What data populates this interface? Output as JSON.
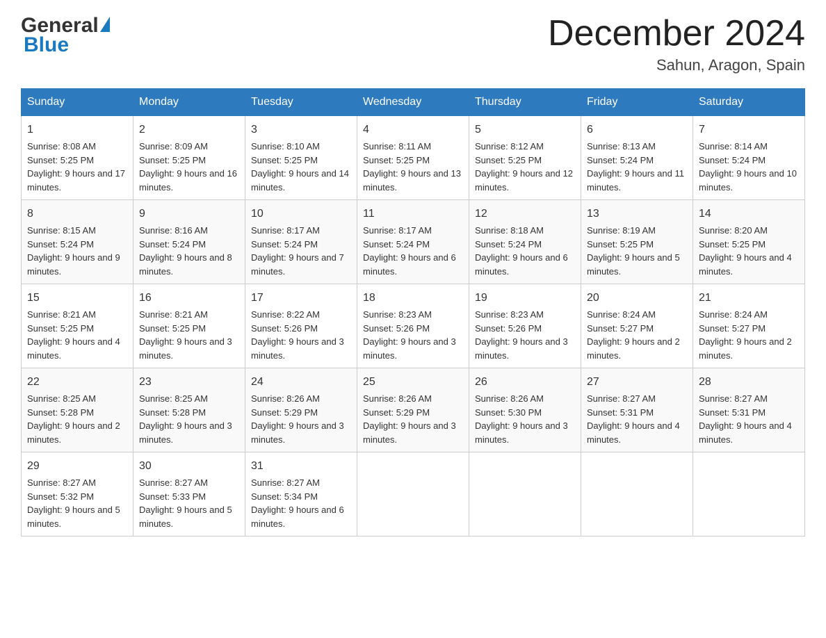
{
  "header": {
    "logo_general": "General",
    "logo_blue": "Blue",
    "month_title": "December 2024",
    "subtitle": "Sahun, Aragon, Spain"
  },
  "days_of_week": [
    "Sunday",
    "Monday",
    "Tuesday",
    "Wednesday",
    "Thursday",
    "Friday",
    "Saturday"
  ],
  "weeks": [
    [
      {
        "day": "1",
        "sunrise": "8:08 AM",
        "sunset": "5:25 PM",
        "daylight": "9 hours and 17 minutes."
      },
      {
        "day": "2",
        "sunrise": "8:09 AM",
        "sunset": "5:25 PM",
        "daylight": "9 hours and 16 minutes."
      },
      {
        "day": "3",
        "sunrise": "8:10 AM",
        "sunset": "5:25 PM",
        "daylight": "9 hours and 14 minutes."
      },
      {
        "day": "4",
        "sunrise": "8:11 AM",
        "sunset": "5:25 PM",
        "daylight": "9 hours and 13 minutes."
      },
      {
        "day": "5",
        "sunrise": "8:12 AM",
        "sunset": "5:25 PM",
        "daylight": "9 hours and 12 minutes."
      },
      {
        "day": "6",
        "sunrise": "8:13 AM",
        "sunset": "5:24 PM",
        "daylight": "9 hours and 11 minutes."
      },
      {
        "day": "7",
        "sunrise": "8:14 AM",
        "sunset": "5:24 PM",
        "daylight": "9 hours and 10 minutes."
      }
    ],
    [
      {
        "day": "8",
        "sunrise": "8:15 AM",
        "sunset": "5:24 PM",
        "daylight": "9 hours and 9 minutes."
      },
      {
        "day": "9",
        "sunrise": "8:16 AM",
        "sunset": "5:24 PM",
        "daylight": "9 hours and 8 minutes."
      },
      {
        "day": "10",
        "sunrise": "8:17 AM",
        "sunset": "5:24 PM",
        "daylight": "9 hours and 7 minutes."
      },
      {
        "day": "11",
        "sunrise": "8:17 AM",
        "sunset": "5:24 PM",
        "daylight": "9 hours and 6 minutes."
      },
      {
        "day": "12",
        "sunrise": "8:18 AM",
        "sunset": "5:24 PM",
        "daylight": "9 hours and 6 minutes."
      },
      {
        "day": "13",
        "sunrise": "8:19 AM",
        "sunset": "5:25 PM",
        "daylight": "9 hours and 5 minutes."
      },
      {
        "day": "14",
        "sunrise": "8:20 AM",
        "sunset": "5:25 PM",
        "daylight": "9 hours and 4 minutes."
      }
    ],
    [
      {
        "day": "15",
        "sunrise": "8:21 AM",
        "sunset": "5:25 PM",
        "daylight": "9 hours and 4 minutes."
      },
      {
        "day": "16",
        "sunrise": "8:21 AM",
        "sunset": "5:25 PM",
        "daylight": "9 hours and 3 minutes."
      },
      {
        "day": "17",
        "sunrise": "8:22 AM",
        "sunset": "5:26 PM",
        "daylight": "9 hours and 3 minutes."
      },
      {
        "day": "18",
        "sunrise": "8:23 AM",
        "sunset": "5:26 PM",
        "daylight": "9 hours and 3 minutes."
      },
      {
        "day": "19",
        "sunrise": "8:23 AM",
        "sunset": "5:26 PM",
        "daylight": "9 hours and 3 minutes."
      },
      {
        "day": "20",
        "sunrise": "8:24 AM",
        "sunset": "5:27 PM",
        "daylight": "9 hours and 2 minutes."
      },
      {
        "day": "21",
        "sunrise": "8:24 AM",
        "sunset": "5:27 PM",
        "daylight": "9 hours and 2 minutes."
      }
    ],
    [
      {
        "day": "22",
        "sunrise": "8:25 AM",
        "sunset": "5:28 PM",
        "daylight": "9 hours and 2 minutes."
      },
      {
        "day": "23",
        "sunrise": "8:25 AM",
        "sunset": "5:28 PM",
        "daylight": "9 hours and 3 minutes."
      },
      {
        "day": "24",
        "sunrise": "8:26 AM",
        "sunset": "5:29 PM",
        "daylight": "9 hours and 3 minutes."
      },
      {
        "day": "25",
        "sunrise": "8:26 AM",
        "sunset": "5:29 PM",
        "daylight": "9 hours and 3 minutes."
      },
      {
        "day": "26",
        "sunrise": "8:26 AM",
        "sunset": "5:30 PM",
        "daylight": "9 hours and 3 minutes."
      },
      {
        "day": "27",
        "sunrise": "8:27 AM",
        "sunset": "5:31 PM",
        "daylight": "9 hours and 4 minutes."
      },
      {
        "day": "28",
        "sunrise": "8:27 AM",
        "sunset": "5:31 PM",
        "daylight": "9 hours and 4 minutes."
      }
    ],
    [
      {
        "day": "29",
        "sunrise": "8:27 AM",
        "sunset": "5:32 PM",
        "daylight": "9 hours and 5 minutes."
      },
      {
        "day": "30",
        "sunrise": "8:27 AM",
        "sunset": "5:33 PM",
        "daylight": "9 hours and 5 minutes."
      },
      {
        "day": "31",
        "sunrise": "8:27 AM",
        "sunset": "5:34 PM",
        "daylight": "9 hours and 6 minutes."
      },
      null,
      null,
      null,
      null
    ]
  ]
}
